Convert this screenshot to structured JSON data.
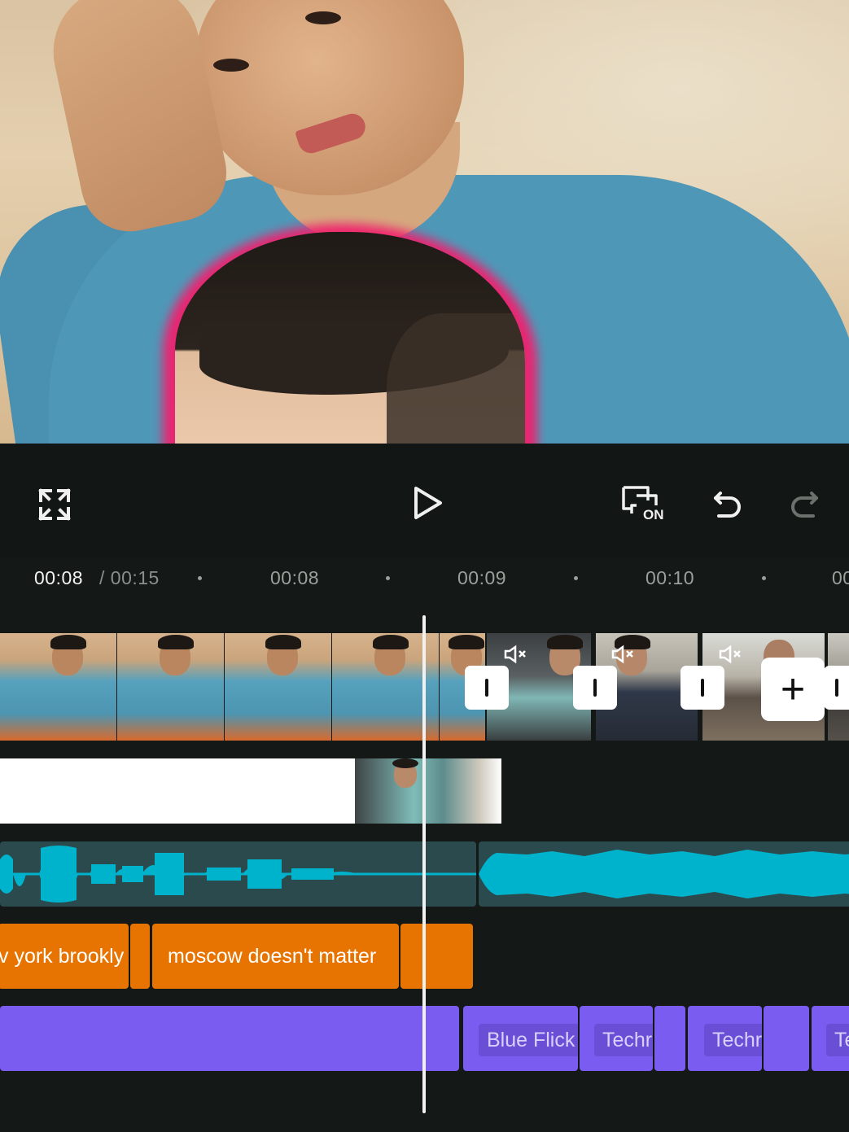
{
  "toolbar": {
    "fullscreen_icon": "fullscreen-expand-icon",
    "play_icon": "play-icon",
    "keyframe_toggle_icon": "keyframe-toggle-icon",
    "keyframe_toggle_label": "ON",
    "undo_icon": "undo-icon",
    "redo_icon": "redo-icon"
  },
  "ruler": {
    "current_time": "00:08",
    "separator_total": "/ 00:15",
    "ticks": [
      "00:08",
      "00:09",
      "00:10",
      "00"
    ]
  },
  "video_track": {
    "mute_icon": "mute-icon",
    "transition_icon": "transition-icon",
    "add_clip_label": "+"
  },
  "text_track": {
    "clips": [
      "v york brookly",
      "moscow doesn't matter"
    ]
  },
  "effect_track": {
    "labels": [
      "Blue Flick",
      "Techr",
      "Techr",
      "Te"
    ]
  },
  "colors": {
    "background": "#141816",
    "text_clip": "#e77400",
    "effect_clip": "#7b5cf0",
    "audio_wave": "#00b3cc",
    "audio_bg": "#2b4a4d"
  }
}
